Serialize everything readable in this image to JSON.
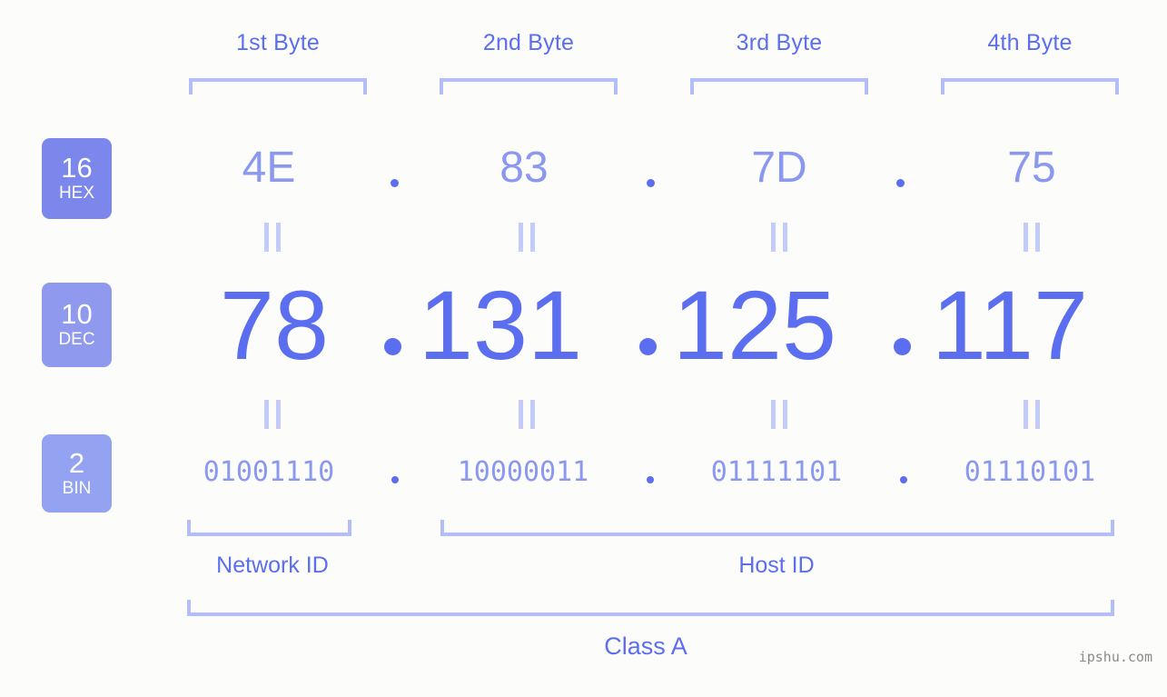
{
  "page": {
    "background_color": "#fcfdfa",
    "accent_color": "#5b6ef0",
    "accent_light_color": "#8b98f0",
    "bracket_color": "#b3bdf7"
  },
  "byte_headers": [
    {
      "label": "1st Byte"
    },
    {
      "label": "2nd Byte"
    },
    {
      "label": "3rd Byte"
    },
    {
      "label": "4th Byte"
    }
  ],
  "radix_badges": [
    {
      "number": "16",
      "name": "HEX",
      "color": "#7b87ea"
    },
    {
      "number": "10",
      "name": "DEC",
      "color": "#8f99ee"
    },
    {
      "number": "2",
      "name": "BIN",
      "color": "#94a2f2"
    }
  ],
  "rows": {
    "hex": {
      "values": [
        "4E",
        "83",
        "7D",
        "75"
      ],
      "separator": "."
    },
    "dec": {
      "values": [
        "78",
        "131",
        "125",
        "117"
      ],
      "separator": "."
    },
    "bin": {
      "values": [
        "01001110",
        "10000011",
        "01111101",
        "01110101"
      ],
      "separator": "."
    }
  },
  "equals_marks": {
    "glyph": "=",
    "count": 8
  },
  "id_sections": [
    {
      "label": "Network ID"
    },
    {
      "label": "Host ID"
    }
  ],
  "class_section": {
    "label": "Class A"
  },
  "watermark": {
    "text": "ipshu.com"
  }
}
